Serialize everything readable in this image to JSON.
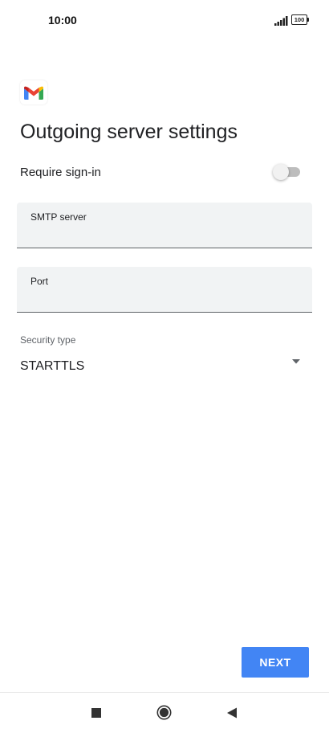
{
  "status_bar": {
    "time": "10:00",
    "battery": "100",
    "icons": [
      "signal-icon",
      "battery-icon"
    ]
  },
  "app": {
    "logo_icon": "gmail-logo-icon",
    "brand_colors": {
      "red": "#EA4335",
      "blue": "#4285F4",
      "green": "#34A853",
      "yellow": "#FBBC04"
    }
  },
  "page": {
    "title": "Outgoing server settings"
  },
  "require_signin": {
    "label": "Require sign-in",
    "enabled": false
  },
  "fields": {
    "smtp": {
      "label": "SMTP server",
      "value": ""
    },
    "port": {
      "label": "Port",
      "value": ""
    }
  },
  "security": {
    "label": "Security type",
    "value": "STARTTLS",
    "icon": "dropdown-arrow-icon"
  },
  "actions": {
    "next_label": "NEXT",
    "accent": "#4285F4"
  },
  "nav": {
    "icons": [
      "recents-icon",
      "home-icon",
      "back-icon"
    ]
  }
}
